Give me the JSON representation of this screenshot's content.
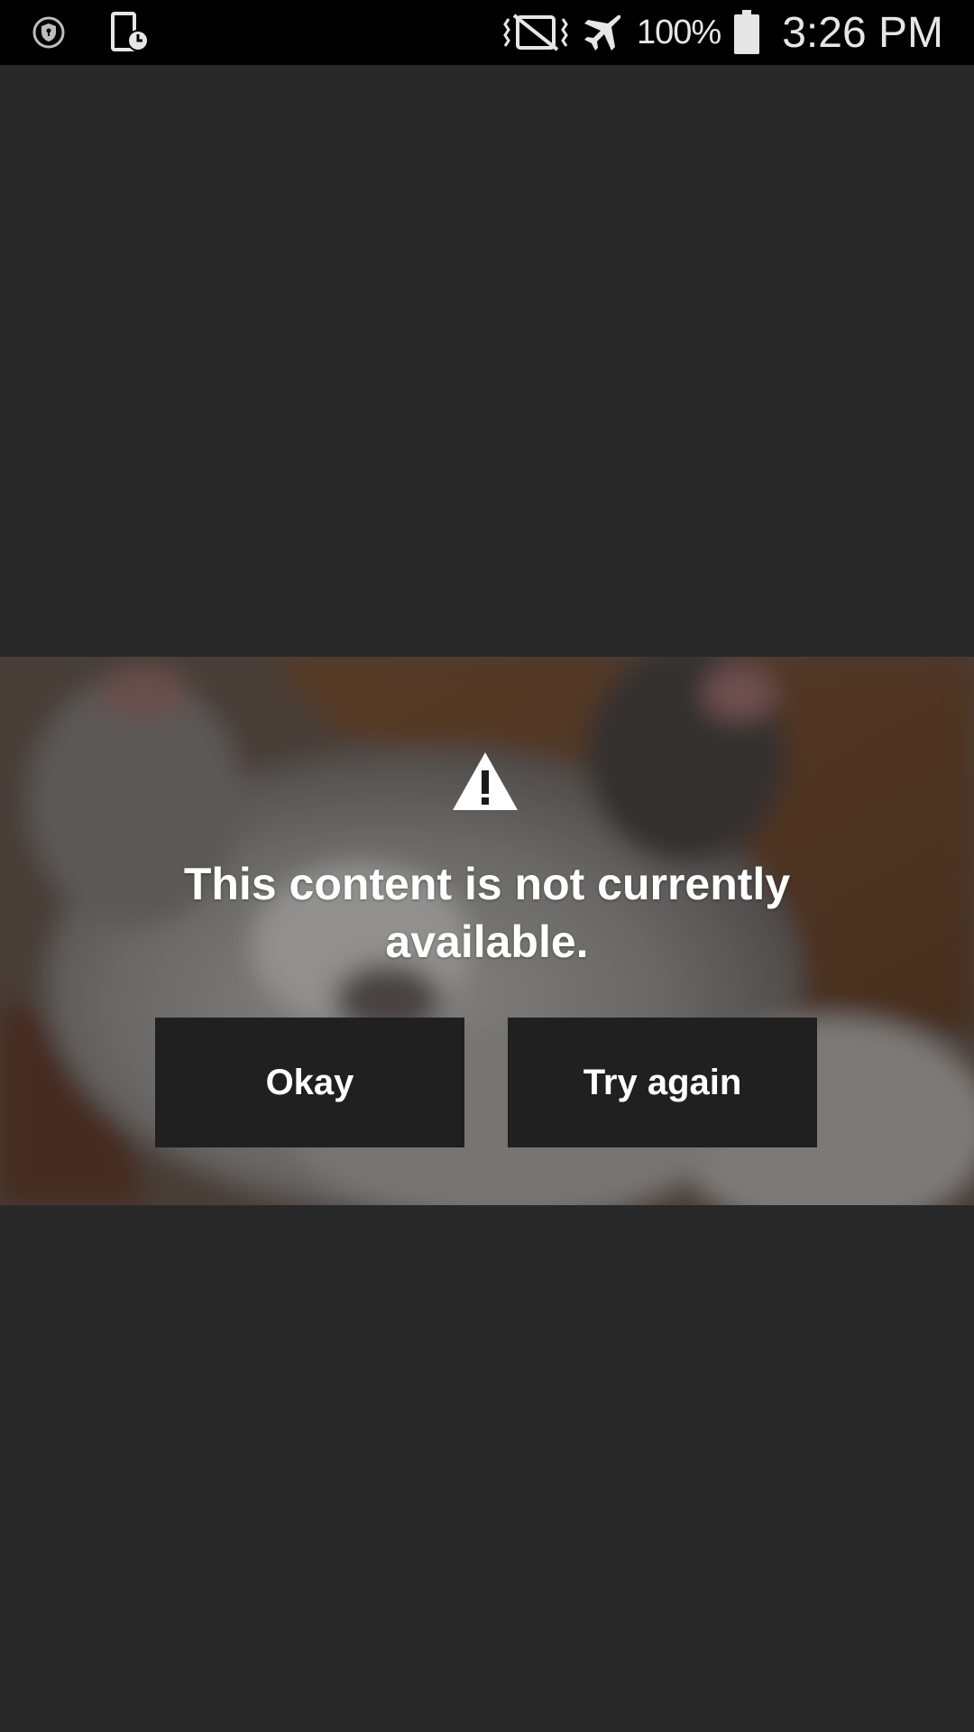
{
  "status_bar": {
    "left_icons": [
      "shield-notification-icon",
      "screen-timeout-icon"
    ],
    "right_icons": [
      "vibrate-off-icon",
      "airplane-mode-icon",
      "battery-icon"
    ],
    "battery_percent": "100%",
    "time": "3:26 PM"
  },
  "player": {
    "thumbnail": "sleeping-kitten-image",
    "warning_icon": "warning-triangle-icon",
    "error_message": "This content is not currently available.",
    "okay_label": "Okay",
    "try_again_label": "Try again"
  },
  "colors": {
    "background": "#282828",
    "status_bar": "#000000",
    "button_bg": "#202020",
    "text": "#ffffff"
  }
}
